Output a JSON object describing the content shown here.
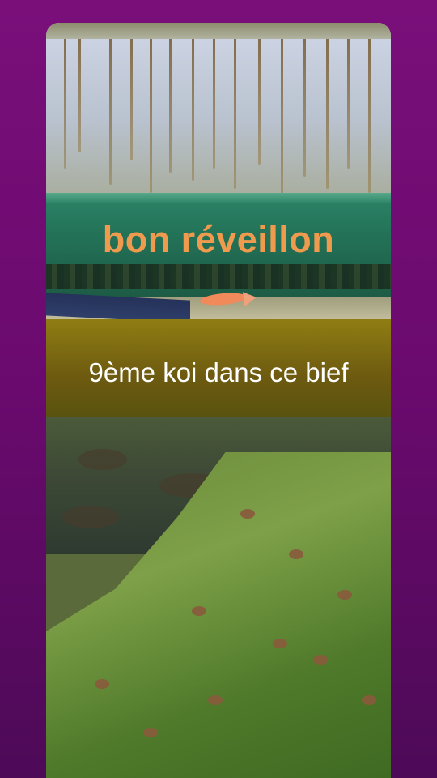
{
  "overlay_text": {
    "headline": "bon réveillon",
    "subtitle": "9ème koi dans ce bief"
  },
  "colors": {
    "background_top": "#7a0f7a",
    "background_bottom": "#4d0a57",
    "headline_color": "#f09a4e",
    "subtitle_color": "#ffffff"
  }
}
